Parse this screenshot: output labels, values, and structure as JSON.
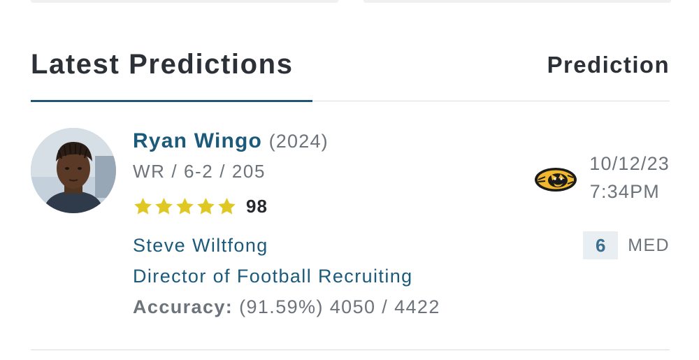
{
  "header": {
    "title": "Latest Predictions",
    "column_label": "Prediction"
  },
  "prediction": {
    "player": {
      "name": "Ryan Wingo",
      "class_year": "(2024)",
      "meta": "WR / 6-2 / 205",
      "stars": 5,
      "rating": "98"
    },
    "expert": {
      "name": "Steve Wiltfong",
      "title": "Director of Football Recruiting",
      "accuracy_label": "Accuracy:",
      "accuracy_value": "(91.59%) 4050 / 4422"
    },
    "team_logo": "tiger-logo-icon",
    "date": "10/12/23",
    "time": "7:34PM",
    "confidence_value": "6",
    "confidence_label": "MED"
  },
  "colors": {
    "accent": "#1f5673",
    "link": "#1c5a7c",
    "muted": "#6d737a",
    "star": "#e0c824",
    "team_gold": "#f1b82d"
  }
}
